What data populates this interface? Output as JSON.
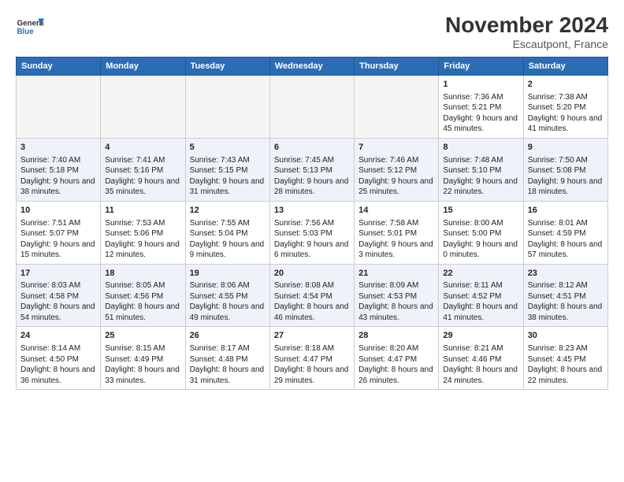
{
  "logo": {
    "line1": "General",
    "line2": "Blue"
  },
  "title": "November 2024",
  "location": "Escautpont, France",
  "weekdays": [
    "Sunday",
    "Monday",
    "Tuesday",
    "Wednesday",
    "Thursday",
    "Friday",
    "Saturday"
  ],
  "rows": [
    [
      {
        "day": "",
        "info": ""
      },
      {
        "day": "",
        "info": ""
      },
      {
        "day": "",
        "info": ""
      },
      {
        "day": "",
        "info": ""
      },
      {
        "day": "",
        "info": ""
      },
      {
        "day": "1",
        "info": "Sunrise: 7:36 AM\nSunset: 5:21 PM\nDaylight: 9 hours and 45 minutes."
      },
      {
        "day": "2",
        "info": "Sunrise: 7:38 AM\nSunset: 5:20 PM\nDaylight: 9 hours and 41 minutes."
      }
    ],
    [
      {
        "day": "3",
        "info": "Sunrise: 7:40 AM\nSunset: 5:18 PM\nDaylight: 9 hours and 38 minutes."
      },
      {
        "day": "4",
        "info": "Sunrise: 7:41 AM\nSunset: 5:16 PM\nDaylight: 9 hours and 35 minutes."
      },
      {
        "day": "5",
        "info": "Sunrise: 7:43 AM\nSunset: 5:15 PM\nDaylight: 9 hours and 31 minutes."
      },
      {
        "day": "6",
        "info": "Sunrise: 7:45 AM\nSunset: 5:13 PM\nDaylight: 9 hours and 28 minutes."
      },
      {
        "day": "7",
        "info": "Sunrise: 7:46 AM\nSunset: 5:12 PM\nDaylight: 9 hours and 25 minutes."
      },
      {
        "day": "8",
        "info": "Sunrise: 7:48 AM\nSunset: 5:10 PM\nDaylight: 9 hours and 22 minutes."
      },
      {
        "day": "9",
        "info": "Sunrise: 7:50 AM\nSunset: 5:08 PM\nDaylight: 9 hours and 18 minutes."
      }
    ],
    [
      {
        "day": "10",
        "info": "Sunrise: 7:51 AM\nSunset: 5:07 PM\nDaylight: 9 hours and 15 minutes."
      },
      {
        "day": "11",
        "info": "Sunrise: 7:53 AM\nSunset: 5:06 PM\nDaylight: 9 hours and 12 minutes."
      },
      {
        "day": "12",
        "info": "Sunrise: 7:55 AM\nSunset: 5:04 PM\nDaylight: 9 hours and 9 minutes."
      },
      {
        "day": "13",
        "info": "Sunrise: 7:56 AM\nSunset: 5:03 PM\nDaylight: 9 hours and 6 minutes."
      },
      {
        "day": "14",
        "info": "Sunrise: 7:58 AM\nSunset: 5:01 PM\nDaylight: 9 hours and 3 minutes."
      },
      {
        "day": "15",
        "info": "Sunrise: 8:00 AM\nSunset: 5:00 PM\nDaylight: 9 hours and 0 minutes."
      },
      {
        "day": "16",
        "info": "Sunrise: 8:01 AM\nSunset: 4:59 PM\nDaylight: 8 hours and 57 minutes."
      }
    ],
    [
      {
        "day": "17",
        "info": "Sunrise: 8:03 AM\nSunset: 4:58 PM\nDaylight: 8 hours and 54 minutes."
      },
      {
        "day": "18",
        "info": "Sunrise: 8:05 AM\nSunset: 4:56 PM\nDaylight: 8 hours and 51 minutes."
      },
      {
        "day": "19",
        "info": "Sunrise: 8:06 AM\nSunset: 4:55 PM\nDaylight: 8 hours and 49 minutes."
      },
      {
        "day": "20",
        "info": "Sunrise: 8:08 AM\nSunset: 4:54 PM\nDaylight: 8 hours and 46 minutes."
      },
      {
        "day": "21",
        "info": "Sunrise: 8:09 AM\nSunset: 4:53 PM\nDaylight: 8 hours and 43 minutes."
      },
      {
        "day": "22",
        "info": "Sunrise: 8:11 AM\nSunset: 4:52 PM\nDaylight: 8 hours and 41 minutes."
      },
      {
        "day": "23",
        "info": "Sunrise: 8:12 AM\nSunset: 4:51 PM\nDaylight: 8 hours and 38 minutes."
      }
    ],
    [
      {
        "day": "24",
        "info": "Sunrise: 8:14 AM\nSunset: 4:50 PM\nDaylight: 8 hours and 36 minutes."
      },
      {
        "day": "25",
        "info": "Sunrise: 8:15 AM\nSunset: 4:49 PM\nDaylight: 8 hours and 33 minutes."
      },
      {
        "day": "26",
        "info": "Sunrise: 8:17 AM\nSunset: 4:48 PM\nDaylight: 8 hours and 31 minutes."
      },
      {
        "day": "27",
        "info": "Sunrise: 8:18 AM\nSunset: 4:47 PM\nDaylight: 8 hours and 29 minutes."
      },
      {
        "day": "28",
        "info": "Sunrise: 8:20 AM\nSunset: 4:47 PM\nDaylight: 8 hours and 26 minutes."
      },
      {
        "day": "29",
        "info": "Sunrise: 8:21 AM\nSunset: 4:46 PM\nDaylight: 8 hours and 24 minutes."
      },
      {
        "day": "30",
        "info": "Sunrise: 8:23 AM\nSunset: 4:45 PM\nDaylight: 8 hours and 22 minutes."
      }
    ]
  ]
}
